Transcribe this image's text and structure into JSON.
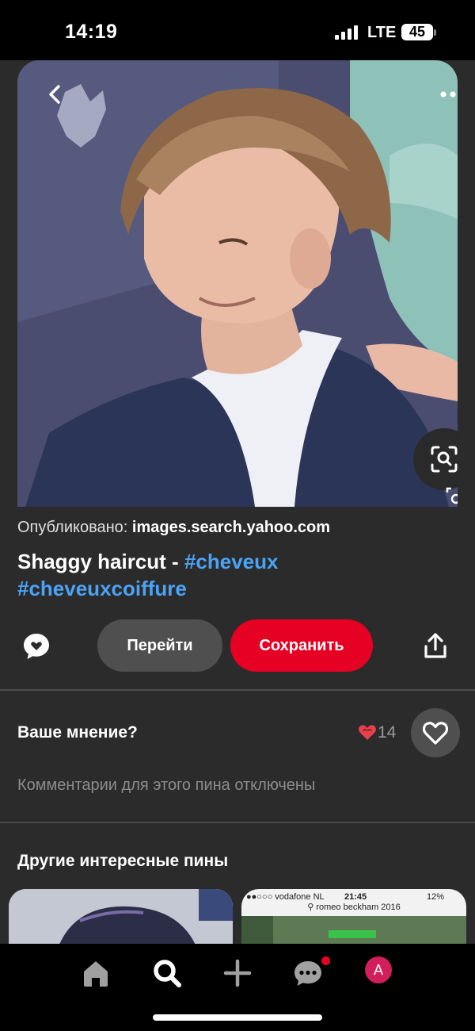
{
  "status_bar": {
    "time": "14:19",
    "network": "LTE",
    "battery": "45"
  },
  "pin": {
    "source_label": "Опубликовано:",
    "source_domain": "images.search.yahoo.com",
    "title_text": "Shaggy haircut -",
    "hashtags": [
      "#cheveux",
      "#cheveuxcoiffure"
    ]
  },
  "actions": {
    "visit_label": "Перейти",
    "save_label": "Сохранить"
  },
  "feedback": {
    "opinion_label": "Ваше мнение?",
    "reaction_count": "14",
    "comments_disabled_text": "Комментарии для этого пина отключены"
  },
  "more_pins": {
    "title": "Другие интересные пины",
    "card2_status": {
      "carrier": "●●○○○ vodafone NL",
      "time": "21:45",
      "battery": "12%"
    },
    "card2_search": "romeo beckham 2016"
  },
  "icons": {
    "back": "chevron-left-icon",
    "more": "more-horizontal-icon",
    "lens": "visual-search-icon",
    "comment": "comment-bubble-icon",
    "share": "share-icon",
    "like": "heart-outline-icon",
    "reaction": "heart-reaction-icon",
    "home": "home-icon",
    "search": "search-icon",
    "create": "plus-icon",
    "messages": "messages-icon"
  },
  "avatar_letter": "A",
  "colors": {
    "accent_red": "#e60023",
    "hashtag_blue": "#4ba3f5",
    "surface": "#2b2b2b",
    "avatar": "#d21f5b"
  }
}
